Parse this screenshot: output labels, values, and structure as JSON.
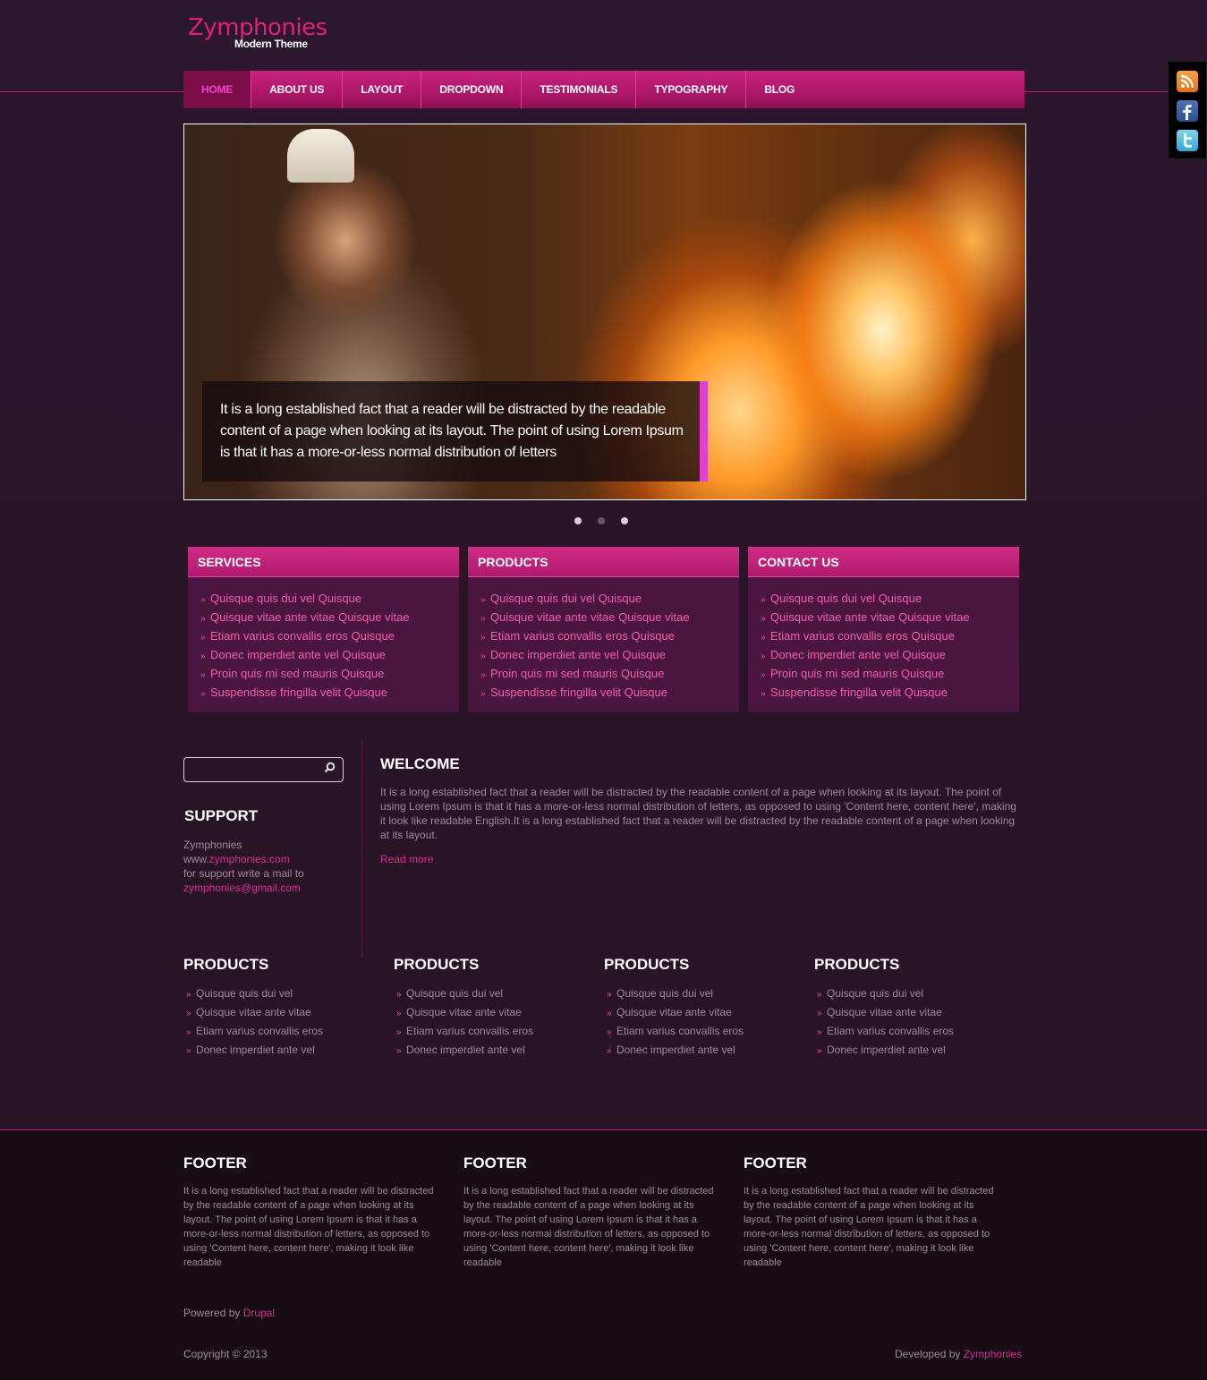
{
  "logo": {
    "name": "Zymphonies",
    "tagline": "Modern Theme"
  },
  "nav": {
    "items": [
      "HOME",
      "ABOUT US",
      "LAYOUT",
      "DROPDOWN",
      "TESTIMONIALS",
      "TYPOGRAPHY",
      "BLOG"
    ],
    "active": "HOME"
  },
  "social": {
    "icons": [
      "rss-icon",
      "facebook-icon",
      "twitter-icon"
    ]
  },
  "slider": {
    "caption": "It is a long established fact that a reader will be distracted by the readable content of a page when looking at its layout. The point of using Lorem Ipsum is that it has a more-or-less normal distribution of letters",
    "slide_count": 3,
    "active_slide": 1
  },
  "boxes": [
    {
      "title": "SERVICES",
      "items": [
        "Quisque quis dui vel Quisque",
        "Quisque vitae ante vitae Quisque vitae",
        "Etiam varius convallis eros Quisque",
        "Donec imperdiet ante vel Quisque",
        "Proin quis mi sed mauris Quisque",
        "Suspendisse fringilla velit Quisque"
      ]
    },
    {
      "title": "PRODUCTS",
      "items": [
        "Quisque quis dui vel Quisque",
        "Quisque vitae ante vitae Quisque vitae",
        "Etiam varius convallis eros Quisque",
        "Donec imperdiet ante vel Quisque",
        "Proin quis mi sed mauris Quisque",
        "Suspendisse fringilla velit Quisque"
      ]
    },
    {
      "title": "CONTACT US",
      "items": [
        "Quisque quis dui vel Quisque",
        "Quisque vitae ante vitae Quisque vitae",
        "Etiam varius convallis eros Quisque",
        "Donec imperdiet ante vel Quisque",
        "Proin quis mi sed mauris Quisque",
        "Suspendisse fringilla velit Quisque"
      ]
    }
  ],
  "search": {
    "placeholder": ""
  },
  "support": {
    "title": "SUPPORT",
    "line1": "Zymphonies",
    "www_prefix": "www.",
    "www_link": "zymphonies.com",
    "line3": "for support write a mail to",
    "email": "zymphonies@gmail.com"
  },
  "welcome": {
    "title": "WELCOME",
    "body": "It is a long established fact that a reader will be distracted by the readable content of a page when looking at its layout. The point of using Lorem Ipsum is that it has a more-or-less normal distribution of letters, as opposed to using 'Content here, content here', making it look like readable English.It is a long established fact that a reader will be distracted by the readable content of a page when looking at its layout.",
    "read_more": "Read more"
  },
  "product_columns": [
    {
      "title": "PRODUCTS",
      "items": [
        "Quisque quis dui vel",
        "Quisque vitae ante vitae",
        "Etiam varius convallis eros",
        "Donec imperdiet ante vel"
      ]
    },
    {
      "title": "PRODUCTS",
      "items": [
        "Quisque quis dui vel",
        "Quisque vitae ante vitae",
        "Etiam varius convallis eros",
        "Donec imperdiet ante vel"
      ]
    },
    {
      "title": "PRODUCTS",
      "items": [
        "Quisque quis dui vel",
        "Quisque vitae ante vitae",
        "Etiam varius convallis eros",
        "Donec imperdiet ante vel"
      ]
    },
    {
      "title": "PRODUCTS",
      "items": [
        "Quisque quis dui vel",
        "Quisque vitae ante vitae",
        "Etiam varius convallis eros",
        "Donec imperdiet ante vel"
      ]
    }
  ],
  "footer": {
    "columns": [
      {
        "title": "FOOTER",
        "text": "It is a long established fact that a reader will be distracted by the readable content of a page when looking at its layout. The point of using Lorem Ipsum is that it has a more-or-less normal distribution of letters, as opposed to using 'Content here, content here', making it look like readable"
      },
      {
        "title": "FOOTER",
        "text": "It is a long established fact that a reader will be distracted by the readable content of a page when looking at its layout. The point of using Lorem Ipsum is that it has a more-or-less normal distribution of letters, as opposed to using 'Content here, content here', making it look like readable"
      },
      {
        "title": "FOOTER",
        "text": "It is a long established fact that a reader will be distracted by the readable content of a page when looking at its layout. The point of using Lorem Ipsum is that it has a more-or-less normal distribution of letters, as opposed to using 'Content here, content here', making it look like readable"
      }
    ],
    "powered_prefix": "Powered by ",
    "powered_link": "Drupal",
    "copyright": "Copyright © 2013",
    "developed_prefix": "Developed by ",
    "developed_link": "Zymphonies"
  },
  "colors": {
    "accent": "#e0207d",
    "nav": "#b3186d",
    "background": "#2a1529",
    "link": "#d12f95"
  }
}
